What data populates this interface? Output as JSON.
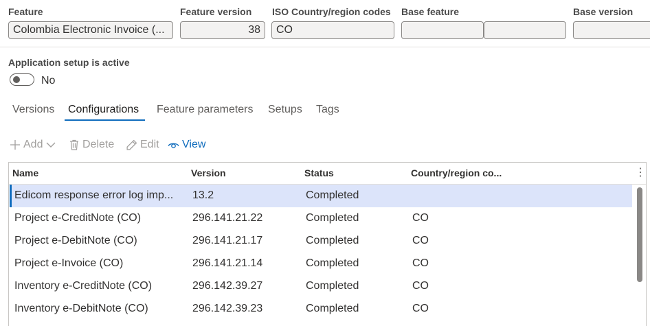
{
  "header": {
    "feature_label": "Feature",
    "feature_value": "Colombia Electronic Invoice (...",
    "version_label": "Feature version",
    "version_value": "38",
    "iso_label": "ISO Country/region codes",
    "iso_value": "CO",
    "base_feature_label": "Base feature",
    "base_feature_value": "",
    "base_feature_value2": "",
    "base_version_label": "Base version",
    "base_version_value": ""
  },
  "app_setup": {
    "label": "Application setup is active",
    "value": "No",
    "on": false
  },
  "tabs": [
    {
      "label": "Versions"
    },
    {
      "label": "Configurations"
    },
    {
      "label": "Feature parameters"
    },
    {
      "label": "Setups"
    },
    {
      "label": "Tags"
    }
  ],
  "active_tab": "Configurations",
  "toolbar": {
    "add": "Add",
    "delete": "Delete",
    "edit": "Edit",
    "view": "View"
  },
  "grid": {
    "columns": [
      "Name",
      "Version",
      "Status",
      "Country/region co..."
    ],
    "rows": [
      {
        "name": "Edicom response error log imp...",
        "version": "13.2",
        "status": "Completed",
        "country": "",
        "selected": true
      },
      {
        "name": "Project e-CreditNote (CO)",
        "version": "296.141.21.22",
        "status": "Completed",
        "country": "CO"
      },
      {
        "name": "Project e-DebitNote (CO)",
        "version": "296.141.21.17",
        "status": "Completed",
        "country": "CO"
      },
      {
        "name": "Project e-Invoice (CO)",
        "version": "296.141.21.14",
        "status": "Completed",
        "country": "CO"
      },
      {
        "name": "Inventory e-CreditNote (CO)",
        "version": "296.142.39.27",
        "status": "Completed",
        "country": "CO"
      },
      {
        "name": "Inventory e-DebitNote (CO)",
        "version": "296.142.39.23",
        "status": "Completed",
        "country": "CO"
      }
    ]
  },
  "icons": [
    "add-icon",
    "chevron-down-icon",
    "delete-icon",
    "edit-icon",
    "view-icon",
    "more-options-icon"
  ],
  "colors": {
    "accent": "#0f6cbd",
    "selected_row": "#dce4fa",
    "disabled": "#a19f9d"
  }
}
